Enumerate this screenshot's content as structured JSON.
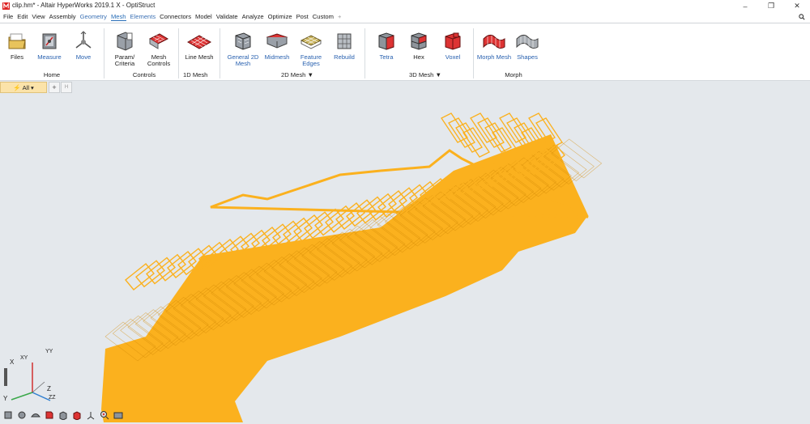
{
  "window": {
    "title": "clip.hm* - Altair HyperWorks 2019.1 X - OptiStruct",
    "minimize": "–",
    "maximize": "❐",
    "close": "✕"
  },
  "menu": {
    "items": [
      {
        "label": "File",
        "style": ""
      },
      {
        "label": "Edit",
        "style": ""
      },
      {
        "label": "View",
        "style": ""
      },
      {
        "label": "Assembly",
        "style": ""
      },
      {
        "label": "Geometry",
        "style": "blue"
      },
      {
        "label": "Mesh",
        "style": "active"
      },
      {
        "label": "Elements",
        "style": "blue"
      },
      {
        "label": "Connectors",
        "style": ""
      },
      {
        "label": "Model",
        "style": ""
      },
      {
        "label": "Validate",
        "style": ""
      },
      {
        "label": "Analyze",
        "style": ""
      },
      {
        "label": "Optimize",
        "style": ""
      },
      {
        "label": "Post",
        "style": ""
      },
      {
        "label": "Custom",
        "style": ""
      }
    ],
    "add": "+"
  },
  "ribbon": {
    "tools": {
      "files": "Files",
      "measure": "Measure",
      "move": "Move",
      "param1": "Param/",
      "param2": "Criteria",
      "meshctl1": "Mesh",
      "meshctl2": "Controls",
      "line_mesh": "Line Mesh",
      "general1": "General 2D",
      "general2": "Mesh",
      "midmesh": "Midmesh",
      "feature1": "Feature",
      "feature2": "Edges",
      "rebuild": "Rebuild",
      "tetra": "Tetra",
      "hex": "Hex",
      "voxel": "Voxel",
      "morph_mesh": "Morph Mesh",
      "shapes": "Shapes"
    },
    "groups": {
      "home": "Home",
      "controls": "Controls",
      "mesh1d": "1D Mesh",
      "mesh2d": "2D Mesh ▼",
      "mesh3d": "3D Mesh ▼",
      "morph": "Morph"
    }
  },
  "modelbar": {
    "all": "All",
    "plus": "+",
    "h": "H"
  },
  "axes": {
    "x": "X",
    "y": "Y",
    "z": "Z",
    "yy": "YY",
    "zz": "ZZ",
    "xy": "XY"
  },
  "colors": {
    "mesh": "#fbb11e",
    "mesh_dark": "#d48a06",
    "viewport": "#e4e8ec",
    "active_tab": "#2a6fb8",
    "accent_red": "#d03030"
  }
}
